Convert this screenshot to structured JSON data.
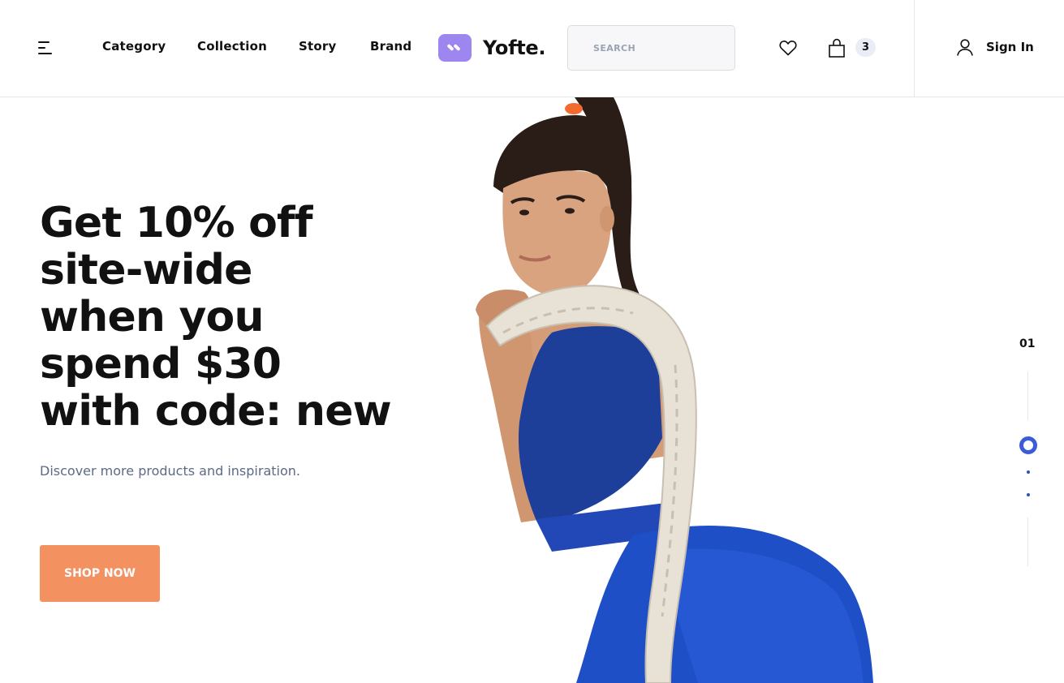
{
  "header": {
    "nav": [
      "Category",
      "Collection",
      "Story",
      "Brand"
    ],
    "logo_text": "Yofte.",
    "search_placeholder": "SEARCH",
    "cart_count": "3",
    "signin_label": "Sign In"
  },
  "hero": {
    "headline_lines": [
      "Get 10% off",
      "site-wide",
      "when you",
      "spend $30",
      "with code: new"
    ],
    "subtext": "Discover more products and inspiration.",
    "cta_label": "SHOP NOW",
    "slide_number": "01"
  },
  "colors": {
    "accent_cta": "#f39161",
    "logo": "#9d86f0",
    "slider_active": "#3b5bd9"
  }
}
